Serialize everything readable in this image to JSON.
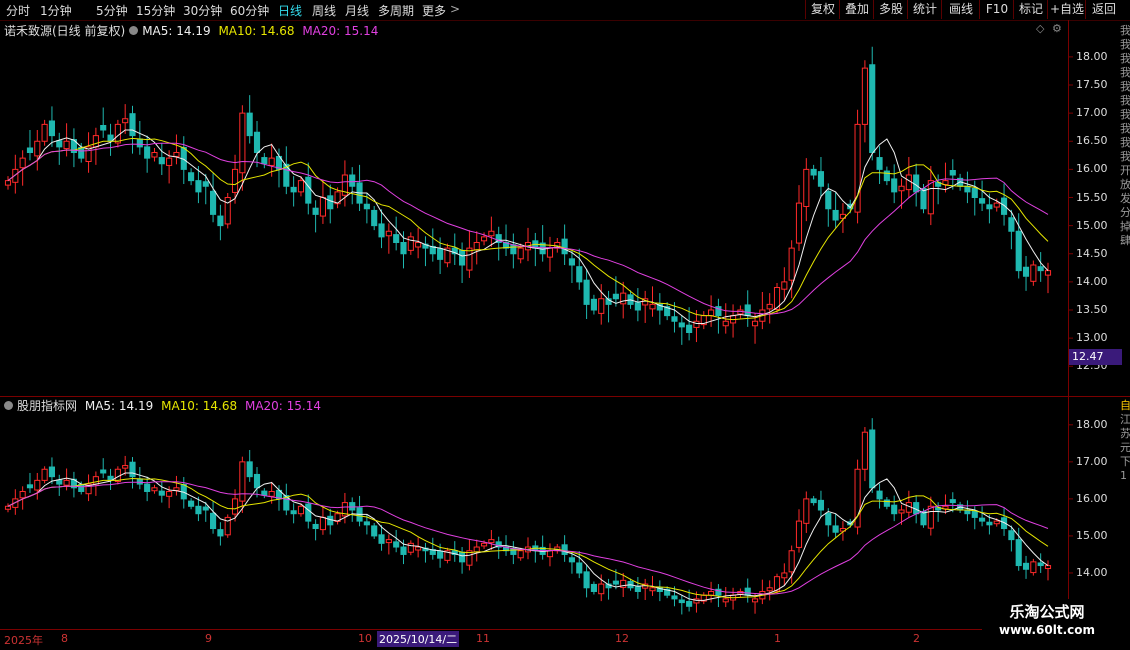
{
  "toolbar": {
    "periods": [
      "分时",
      "1分钟",
      "5分钟",
      "15分钟",
      "30分钟",
      "60分钟",
      "日线",
      "周线",
      "月线",
      "多周期",
      "更多"
    ],
    "active_period": "日线",
    "more_chevron": ">",
    "buttons": [
      "复权",
      "叠加",
      "多股",
      "统计",
      "画线",
      "F10",
      "标记",
      "+自选",
      "返回"
    ]
  },
  "main_panel": {
    "stock_title": "诺禾致源(日线 前复权)",
    "ma5_label": "MA5: 14.19",
    "ma10_label": "MA10: 14.68",
    "ma20_label": "MA20: 15.14",
    "y_ticks": [
      "18.00",
      "17.50",
      "17.00",
      "16.50",
      "16.00",
      "15.50",
      "15.00",
      "14.50",
      "14.00",
      "13.50",
      "13.00",
      "12.50"
    ],
    "current_price_tag": "12.47",
    "side_chars": [
      "我",
      "我",
      "我",
      "我",
      "我",
      "我",
      "我",
      "我",
      "我",
      "我",
      "开",
      "放",
      "发",
      "分",
      "掉",
      "肆"
    ]
  },
  "indicator_panel": {
    "title": "股朋指标网",
    "ma5_label": "MA5: 14.19",
    "ma10_label": "MA10: 14.68",
    "ma20_label": "MA20: 15.14",
    "y_ticks": [
      "18.00",
      "17.00",
      "16.00",
      "15.00",
      "14.00",
      "13.00"
    ],
    "side_chars": [
      "自",
      "江",
      "苏",
      "元",
      "下",
      "1"
    ]
  },
  "time_axis": {
    "labels": [
      "2025年",
      "8",
      "9",
      "10",
      "2025/10/14/二",
      "11",
      "12",
      "1",
      "2"
    ]
  },
  "watermark": {
    "title": "乐淘公式网",
    "url": "www.60lt.com"
  },
  "colors": {
    "up": "#ff2a2a",
    "down": "#1fb8b0",
    "ma5": "#f0f0f0",
    "ma10": "#e6e600",
    "ma20": "#e040e0",
    "active_period": "#33ddee",
    "price_tag_bg": "#3a1a7a"
  },
  "chart_data": {
    "type": "candlestick",
    "series_note": "",
    "close": [
      15.8,
      16.0,
      16.2,
      16.3,
      16.5,
      16.8,
      16.6,
      16.4,
      16.5,
      16.3,
      16.2,
      16.4,
      16.6,
      16.7,
      16.5,
      16.8,
      16.9,
      16.6,
      16.4,
      16.2,
      16.3,
      16.1,
      16.2,
      16.3,
      16.0,
      15.8,
      15.6,
      15.7,
      15.2,
      15.0,
      15.5,
      16.0,
      17.0,
      16.6,
      16.3,
      16.1,
      16.2,
      16.0,
      15.7,
      15.6,
      15.8,
      15.4,
      15.2,
      15.5,
      15.3,
      15.6,
      15.9,
      15.7,
      15.4,
      15.3,
      15.0,
      14.8,
      14.9,
      14.7,
      14.5,
      14.8,
      14.7,
      14.6,
      14.5,
      14.4,
      14.6,
      14.5,
      14.3,
      14.6,
      14.7,
      14.8,
      14.9,
      14.7,
      14.6,
      14.5,
      14.6,
      14.7,
      14.6,
      14.5,
      14.6,
      14.7,
      14.5,
      14.3,
      14.0,
      13.6,
      13.5,
      13.7,
      13.6,
      13.7,
      13.8,
      13.6,
      13.5,
      13.7,
      13.6,
      13.5,
      13.4,
      13.3,
      13.2,
      13.1,
      13.3,
      13.4,
      13.5,
      13.4,
      13.3,
      13.4,
      13.5,
      13.4,
      13.3,
      13.5,
      13.6,
      13.9,
      14.0,
      14.6,
      15.4,
      16.0,
      15.9,
      15.7,
      15.3,
      15.1,
      15.2,
      15.3,
      16.8,
      17.8,
      16.3,
      16.0,
      15.8,
      15.6,
      15.7,
      15.9,
      15.6,
      15.3,
      15.8,
      15.7,
      15.8,
      15.9,
      15.7,
      15.6,
      15.5,
      15.4,
      15.3,
      15.4,
      15.2,
      14.9,
      14.2,
      14.1,
      14.3,
      14.2,
      14.2
    ]
  }
}
